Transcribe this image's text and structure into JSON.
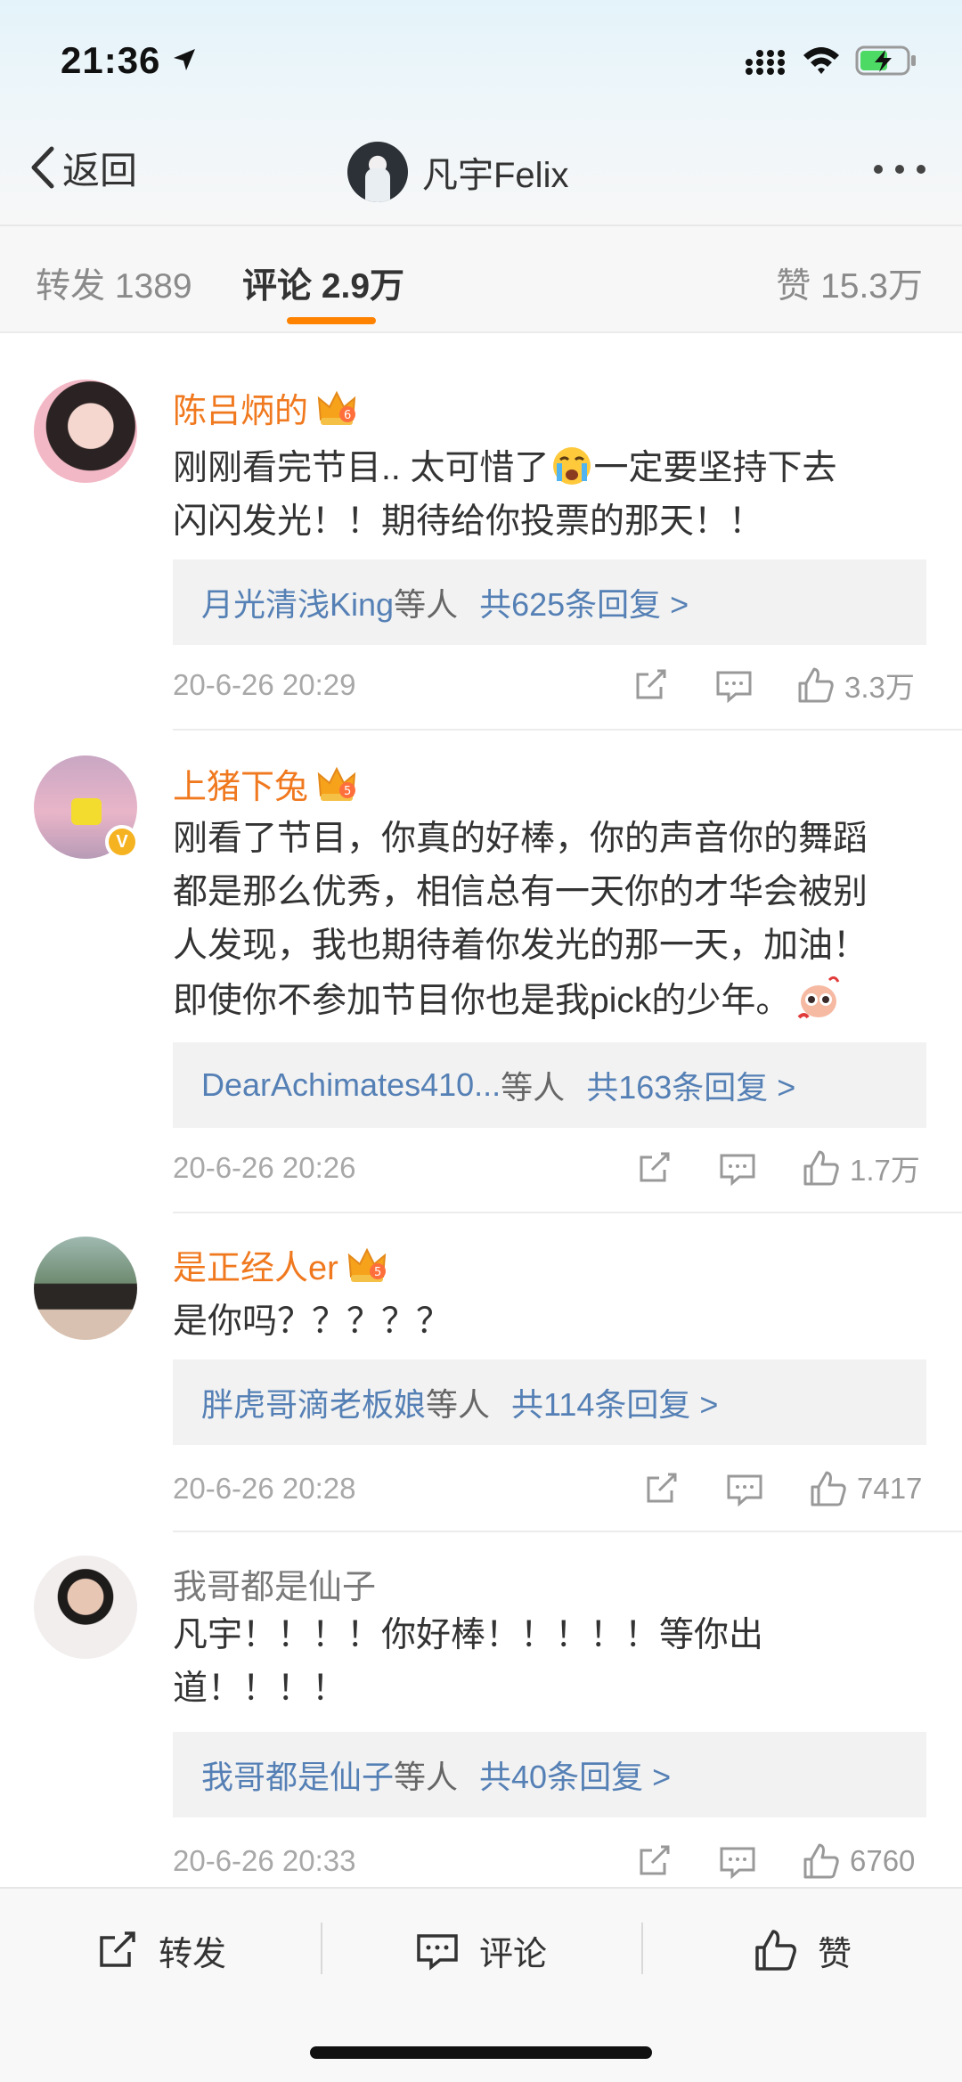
{
  "status_bar": {
    "time": "21:36"
  },
  "nav": {
    "back_label": "返回",
    "title": "凡宇Felix"
  },
  "tabs": {
    "repost": "转发 1389",
    "comment": "评论 2.9万",
    "like": "赞 15.3万"
  },
  "comments": [
    {
      "username": "陈吕炳的",
      "text_line1_a": "刚刚看完节目.. 太可惜了",
      "text_line1_b": "一定要坚持下去",
      "text_line2": "闪闪发光！！期待给你投票的那天！！",
      "reply_user": "月光清浅King",
      "reply_etc": "等人",
      "reply_count": "共625条回复 >",
      "time": "20-6-26 20:29",
      "likes": "3.3万"
    },
    {
      "username": "上猪下兔",
      "text_line1": "刚看了节目，你真的好棒，你的声音你的舞蹈",
      "text_line2": "都是那么优秀，相信总有一天你的才华会被别",
      "text_line3": "人发现，我也期待着你发光的那一天，加油！",
      "text_line4": "即使你不参加节目你也是我pick的少年。",
      "reply_user": "DearAchimates410...",
      "reply_etc": "等人",
      "reply_count": "共163条回复 >",
      "time": "20-6-26 20:26",
      "likes": "1.7万"
    },
    {
      "username": "是正经人er",
      "text_line1": "是你吗？？？？？",
      "reply_user": "胖虎哥滴老板娘",
      "reply_etc": "等人",
      "reply_count": "共114条回复 >",
      "time": "20-6-26 20:28",
      "likes": "7417"
    },
    {
      "username": "我哥都是仙子",
      "text_line1": "凡宇！！！！你好棒！！！！！等你出",
      "text_line2": "道！！！！",
      "reply_user": "我哥都是仙子",
      "reply_etc": "等人",
      "reply_count": "共40条回复 >",
      "time": "20-6-26 20:33",
      "likes": "6760"
    }
  ],
  "bottom_bar": {
    "repost": "转发",
    "comment": "评论",
    "like": "赞"
  },
  "colors": {
    "accent": "#ff8200",
    "username": "#f0791f",
    "link": "#5580b5"
  }
}
